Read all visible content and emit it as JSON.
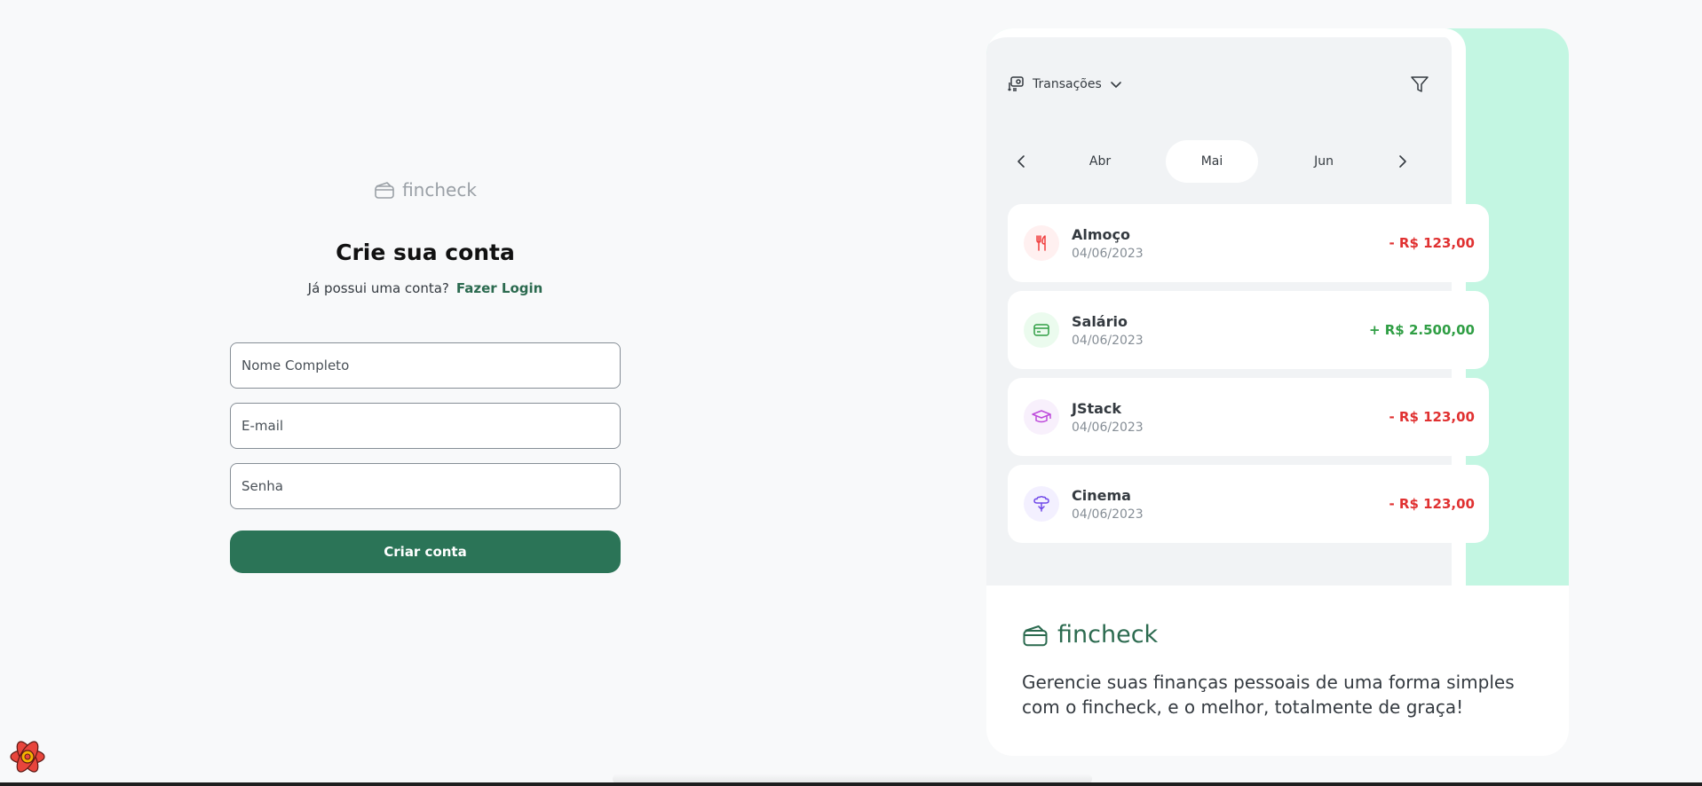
{
  "signup": {
    "brand": "fincheck",
    "title": "Crie sua conta",
    "has_account_text": "Já possui uma conta?",
    "login_link": "Fazer Login",
    "name_placeholder": "Nome Completo",
    "email_placeholder": "E-mail",
    "password_placeholder": "Senha",
    "submit_label": "Criar conta"
  },
  "showcase": {
    "transactions_label": "Transações",
    "months": [
      "Abr",
      "Mai",
      "Jun"
    ],
    "active_month": "Mai",
    "transactions": [
      {
        "name": "Almoço",
        "date": "04/06/2023",
        "amount": "- R$ 123,00",
        "type": "expense",
        "icon": "fork-knife-icon",
        "icon_color": "#f03e3e",
        "icon_bg": "#fff0f0"
      },
      {
        "name": "Salário",
        "date": "04/06/2023",
        "amount": "+ R$ 2.500,00",
        "type": "income",
        "icon": "card-icon",
        "icon_color": "#2f9e44",
        "icon_bg": "#ebfbee"
      },
      {
        "name": "JStack",
        "date": "04/06/2023",
        "amount": "- R$ 123,00",
        "type": "expense",
        "icon": "graduation-cap-icon",
        "icon_color": "#be4bdb",
        "icon_bg": "#f8f0fc"
      },
      {
        "name": "Cinema",
        "date": "04/06/2023",
        "amount": "- R$ 123,00",
        "type": "expense",
        "icon": "popcorn-icon",
        "icon_color": "#7048e8",
        "icon_bg": "#f3f0ff"
      }
    ],
    "brand": "fincheck",
    "tagline": "Gerencie suas finanças pessoais de uma forma simples com o fincheck, e o melhor, totalmente de graça!"
  },
  "colors": {
    "primary": "#2b7457",
    "mint": "#c3f6e2",
    "expense": "#e03131",
    "income": "#2f9e44"
  }
}
